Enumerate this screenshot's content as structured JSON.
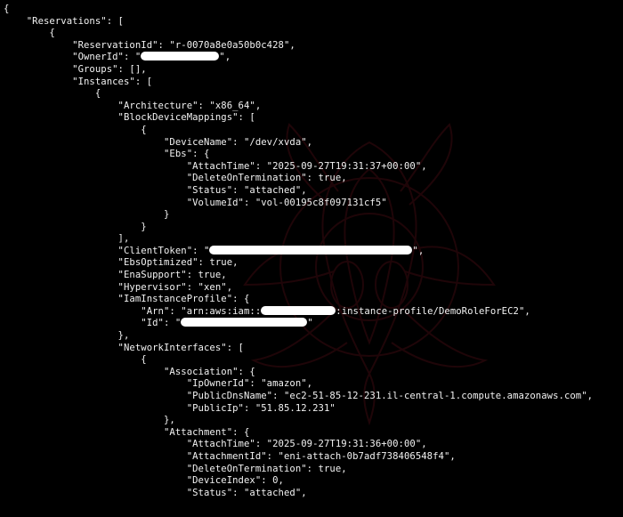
{
  "watermark_icon": "beetle-emblem",
  "colors": {
    "background": "#000000",
    "text": "#f2f2f2",
    "redaction": "#ffffff",
    "watermark": "#3a0a10"
  },
  "lines": [
    {
      "text": "{"
    },
    {
      "text": "    \"Reservations\": ["
    },
    {
      "text": "        {"
    },
    {
      "text": "            \"ReservationId\": \"r-0070a8e0a50b0c428\","
    },
    {
      "text": "            \"OwnerId\": \"",
      "redact": "owner-id",
      "after": "\","
    },
    {
      "text": "            \"Groups\": [],"
    },
    {
      "text": "            \"Instances\": ["
    },
    {
      "text": "                {"
    },
    {
      "text": "                    \"Architecture\": \"x86_64\","
    },
    {
      "text": "                    \"BlockDeviceMappings\": ["
    },
    {
      "text": "                        {"
    },
    {
      "text": "                            \"DeviceName\": \"/dev/xvda\","
    },
    {
      "text": "                            \"Ebs\": {"
    },
    {
      "text": "                                \"AttachTime\": \"2025-09-27T19:31:37+00:00\","
    },
    {
      "text": "                                \"DeleteOnTermination\": true,"
    },
    {
      "text": "                                \"Status\": \"attached\","
    },
    {
      "text": "                                \"VolumeId\": \"vol-00195c8f097131cf5\""
    },
    {
      "text": "                            }"
    },
    {
      "text": "                        }"
    },
    {
      "text": "                    ],"
    },
    {
      "text": "                    \"ClientToken\": \"",
      "redact": "client-token",
      "after": "\","
    },
    {
      "text": "                    \"EbsOptimized\": true,"
    },
    {
      "text": "                    \"EnaSupport\": true,"
    },
    {
      "text": "                    \"Hypervisor\": \"xen\","
    },
    {
      "text": "                    \"IamInstanceProfile\": {"
    },
    {
      "text": "                        \"Arn\": \"arn:aws:iam::",
      "redact": "account-id",
      "after": ":instance-profile/DemoRoleForEC2\","
    },
    {
      "text": "                        \"Id\": \"",
      "redact": "profile-id",
      "after": "\""
    },
    {
      "text": "                    },"
    },
    {
      "text": "                    \"NetworkInterfaces\": ["
    },
    {
      "text": "                        {"
    },
    {
      "text": "                            \"Association\": {"
    },
    {
      "text": "                                \"IpOwnerId\": \"amazon\","
    },
    {
      "text": "                                \"PublicDnsName\": \"ec2-51-85-12-231.il-central-1.compute.amazonaws.com\","
    },
    {
      "text": "                                \"PublicIp\": \"51.85.12.231\""
    },
    {
      "text": "                            },"
    },
    {
      "text": "                            \"Attachment\": {"
    },
    {
      "text": "                                \"AttachTime\": \"2025-09-27T19:31:36+00:00\","
    },
    {
      "text": "                                \"AttachmentId\": \"eni-attach-0b7adf738406548f4\","
    },
    {
      "text": "                                \"DeleteOnTermination\": true,"
    },
    {
      "text": "                                \"DeviceIndex\": 0,"
    },
    {
      "text": "                                \"Status\": \"attached\","
    }
  ]
}
